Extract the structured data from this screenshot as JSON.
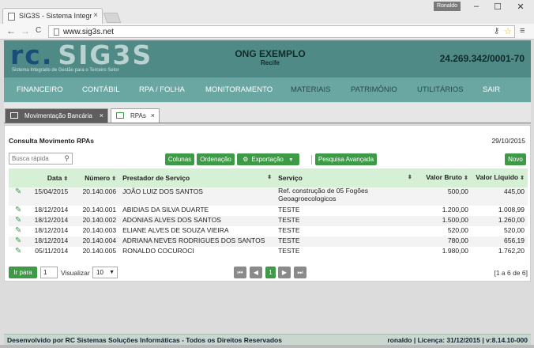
{
  "browser": {
    "tab_title": "SIG3S - Sistema Integrado",
    "tab_close": "×",
    "user_badge": "Ronaldo",
    "url": "www.sig3s.net",
    "win_min": "–",
    "win_max": "☐",
    "win_close": "✕",
    "back": "←",
    "forward": "→",
    "reload": "C",
    "key_glyph": "⚷",
    "star_glyph": "☆",
    "menu_glyph": "≡"
  },
  "header": {
    "logo_rc": "rc.",
    "logo_sig": "SIG3S",
    "logo_subtitle": "Sistema Integrado de Gestão para o Terceiro Setor",
    "org_name": "ONG EXEMPLO",
    "org_city": "Recife",
    "cnpj": "24.269.342/0001-70"
  },
  "menu": {
    "items": [
      "FINANCEIRO",
      "CONTÁBIL",
      "RPA / FOLHA",
      "MONITORAMENTO",
      "MATERIAIS",
      "PATRIMÔNIO",
      "UTILITÁRIOS",
      "SAIR"
    ]
  },
  "worktabs": [
    {
      "label": "Movimentação Bancária",
      "close": "×"
    },
    {
      "label": "RPAs",
      "close": "×"
    }
  ],
  "panel": {
    "title": "Consulta Movimento RPAs",
    "date": "29/10/2015",
    "search_placeholder": "Busca rápida",
    "search_icon": "⚲",
    "buttons": {
      "colunas": "Colunas",
      "ordenacao": "Ordenação",
      "exportacao": "Exportação",
      "exportacao_caret": "▼",
      "pesquisa": "Pesquisa Avançada",
      "novo": "Novo"
    },
    "columns": {
      "data": "Data",
      "numero": "Número",
      "prestador": "Prestador de Serviço",
      "servico": "Serviço",
      "valor_bruto": "Valor Bruto",
      "valor_liquido": "Valor Líquido",
      "sort_glyph": "⬍"
    },
    "edit_glyph": "✎",
    "rows": [
      {
        "data": "15/04/2015",
        "numero": "20.140.006",
        "prestador": "JOÃO LUIZ DOS SANTOS",
        "servico": "Ref. construção de 05 Fogões Geoagroecologicos",
        "bruto": "500,00",
        "liquido": "445,00"
      },
      {
        "data": "18/12/2014",
        "numero": "20.140.001",
        "prestador": "ABIDIAS DA SILVA DUARTE",
        "servico": "TESTE",
        "bruto": "1.200,00",
        "liquido": "1.008,99"
      },
      {
        "data": "18/12/2014",
        "numero": "20.140.002",
        "prestador": "ADONIAS ALVES DOS SANTOS",
        "servico": "TESTE",
        "bruto": "1.500,00",
        "liquido": "1.260,00"
      },
      {
        "data": "18/12/2014",
        "numero": "20.140.003",
        "prestador": "ELIANE ALVES DE SOUZA VIEIRA",
        "servico": "TESTE",
        "bruto": "520,00",
        "liquido": "520,00"
      },
      {
        "data": "18/12/2014",
        "numero": "20.140.004",
        "prestador": "ADRIANA NEVES RODRIGUES DOS SANTOS",
        "servico": "TESTE",
        "bruto": "780,00",
        "liquido": "656,19"
      },
      {
        "data": "05/11/2014",
        "numero": "20.140.005",
        "prestador": "RONALDO COCUROCI",
        "servico": "TESTE",
        "bruto": "1.980,00",
        "liquido": "1.762,20"
      }
    ],
    "pager": {
      "ir_para": "Ir para",
      "page_value": "1",
      "visualizar": "Visualizar",
      "per_page": "10",
      "per_page_caret": "▼",
      "first": "⏮",
      "prev": "◀",
      "current": "1",
      "next": "▶",
      "last": "⏭",
      "range": "[1 a 6 de 6]"
    }
  },
  "status": {
    "left": "Desenvolvido por RC Sistemas Soluções Informáticas - Todos os Direitos Reservados",
    "right": "ronaldo | Licença: 31/12/2015 | v:8.14.10-000"
  }
}
